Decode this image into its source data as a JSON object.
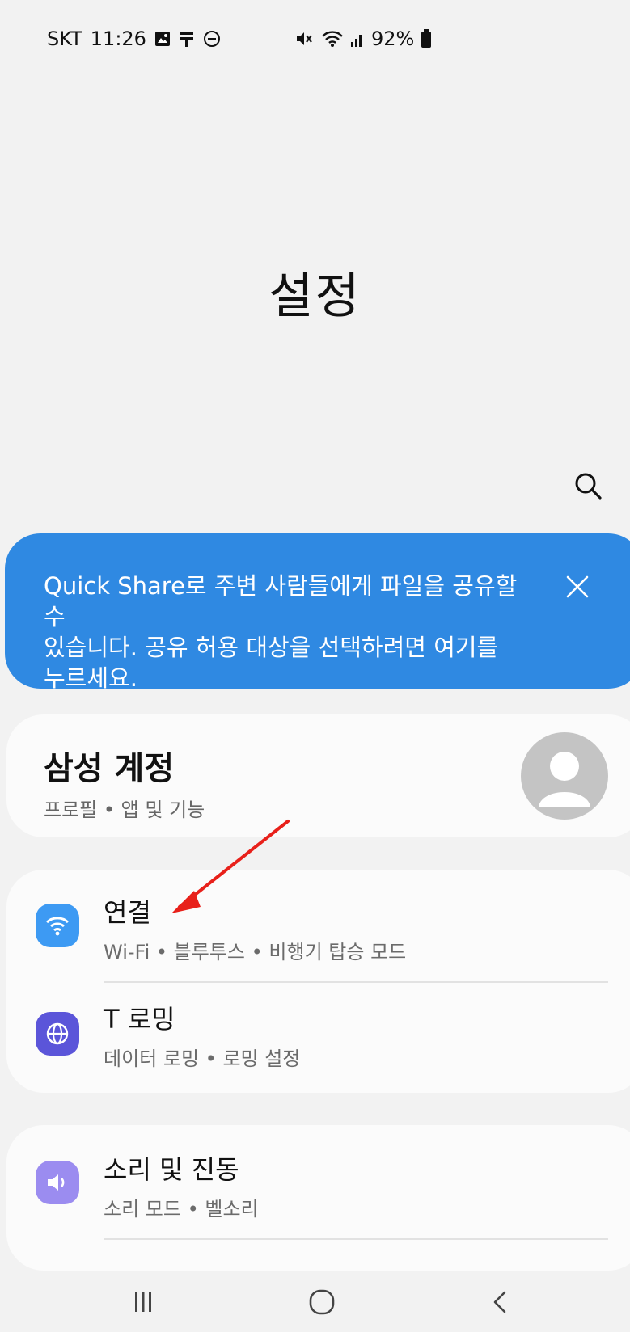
{
  "status_bar": {
    "carrier": "SKT",
    "time": "11:26",
    "battery": "92%",
    "icons_left": [
      "gallery-icon",
      "usb-debug-icon",
      "do-not-disturb-icon"
    ],
    "icons_right": [
      "mute-icon",
      "wifi-icon",
      "signal-icon",
      "battery-icon"
    ]
  },
  "header": {
    "title": "설정"
  },
  "search": {
    "icon": "search-icon"
  },
  "quick_share_banner": {
    "text": "Quick Share로 주변 사람들에게 파일을 공유할 수\n있습니다. 공유 허용 대상을 선택하려면 여기를\n누르세요.",
    "background": "#2f89e2"
  },
  "account": {
    "title": "삼성 계정",
    "subtitle": "프로필 • 앱 및 기능"
  },
  "settings_groups": [
    {
      "items": [
        {
          "title": "연결",
          "subtitle": "Wi-Fi • 블루투스 • 비행기 탑승 모드",
          "icon": "wifi-icon",
          "icon_color": "#3d9af3"
        },
        {
          "title": "T 로밍",
          "subtitle": "데이터 로밍 • 로밍 설정",
          "icon": "globe-icon",
          "icon_color": "#5b55d9"
        }
      ]
    },
    {
      "items": [
        {
          "title": "소리 및 진동",
          "subtitle": "소리 모드 • 벨소리",
          "icon": "speaker-icon",
          "icon_color": "#9b8cf0"
        }
      ]
    }
  ],
  "annotation": {
    "color": "#e8201a"
  },
  "nav_bar": {
    "buttons": [
      "recent-apps-icon",
      "home-icon",
      "back-icon"
    ]
  }
}
